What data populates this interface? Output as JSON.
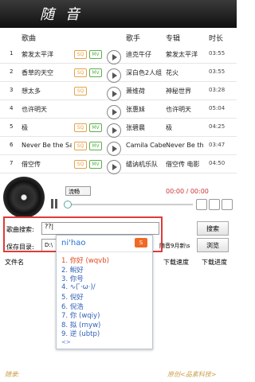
{
  "app": {
    "logo": "随 音"
  },
  "columns": {
    "song": "歌曲",
    "singer": "歌手",
    "album": "专辑",
    "duration": "时长"
  },
  "songs": [
    {
      "num": "1",
      "title": "萦发太平洋",
      "sq": "SQ",
      "mv": "MV",
      "artist": "迪克牛仔",
      "album": "萦发太平洋",
      "duration": "03:55"
    },
    {
      "num": "2",
      "title": "香草的天空",
      "sq": "SQ",
      "mv": "MV",
      "artist": "深白色2人组",
      "album": "花火",
      "duration": "03:55"
    },
    {
      "num": "3",
      "title": "想太多",
      "sq": "SQ",
      "mv": "",
      "artist": "萧维荷",
      "album": "神秘世界",
      "duration": "03:28"
    },
    {
      "num": "4",
      "title": "也许明天",
      "sq": "",
      "mv": "",
      "artist": "张惠妹",
      "album": "也许明天",
      "duration": "05:04"
    },
    {
      "num": "5",
      "title": "极",
      "sq": "SQ",
      "mv": "MV",
      "artist": "张碧晨",
      "album": "极",
      "duration": "04:25"
    },
    {
      "num": "6",
      "title": "Never Be the Sa",
      "sq": "SQ",
      "mv": "MV",
      "artist": "Camila Cabe",
      "album": "Never Be th",
      "duration": "03:47"
    },
    {
      "num": "7",
      "title": "借空传",
      "sq": "SQ",
      "mv": "MV",
      "artist": "缱讷机乐队",
      "album": "借空传 电影",
      "duration": "04:50"
    }
  ],
  "player": {
    "quality": "流畅",
    "time": "00:00 / 00:00",
    "progress": 0
  },
  "search": {
    "label": "歌曲搜索:",
    "value": "??|",
    "button": "搜索"
  },
  "save": {
    "label": "保存目录:",
    "value": "D:\\",
    "tail": "随音9月新\\s",
    "button": "浏览"
  },
  "downloads": {
    "file": "文件名",
    "speed": "下载速度",
    "progress": "下载进度"
  },
  "ime": {
    "pinyin": "ni'hao",
    "candidates": [
      "1. 你好 (wqvb)",
      "2. 鲵好",
      "3. 你号",
      "4. ∿( ̄·ω·)/",
      "5. 倪好",
      "6. 倪浩",
      "7. 你 (wqiy)",
      "8. 拟 (rnyw)",
      "9. 逆 (ubtp)"
    ],
    "more": "<>"
  },
  "footer": {
    "left": "随录:",
    "right": "原创<品素科技>"
  }
}
